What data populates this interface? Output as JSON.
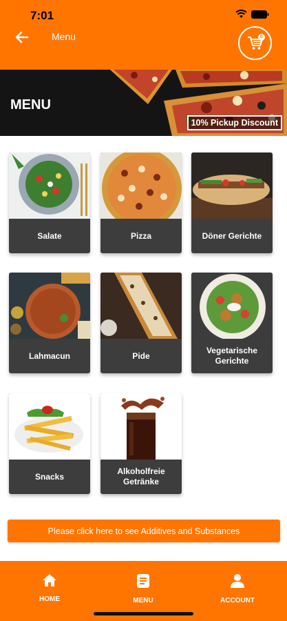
{
  "status_bar": {
    "time": "7:01"
  },
  "header": {
    "back_icon": "arrow-left-icon",
    "title": "Menu",
    "cart_icon": "shopping-cart-icon",
    "cart_count": "0"
  },
  "banner": {
    "title": "MENU",
    "discount": "10% Pickup Discount"
  },
  "categories": [
    {
      "label": "Salate"
    },
    {
      "label": "Pizza"
    },
    {
      "label": "Döner Gerichte"
    },
    {
      "label": "Lahmacun"
    },
    {
      "label": "Pide"
    },
    {
      "label": "Vegetarische Gerichte"
    },
    {
      "label": "Snacks"
    },
    {
      "label": "Alkoholfreie Getränke"
    }
  ],
  "additives_button": "Please click here to see Additives and Substances",
  "bottom_nav": [
    {
      "label": "HOME",
      "icon": "home-icon"
    },
    {
      "label": "MENU",
      "icon": "menu-document-icon"
    },
    {
      "label": "ACCOUNT",
      "icon": "person-icon"
    }
  ],
  "colors": {
    "brand": "#ff7500",
    "card": "#3d3d3d",
    "banner": "#141414"
  }
}
